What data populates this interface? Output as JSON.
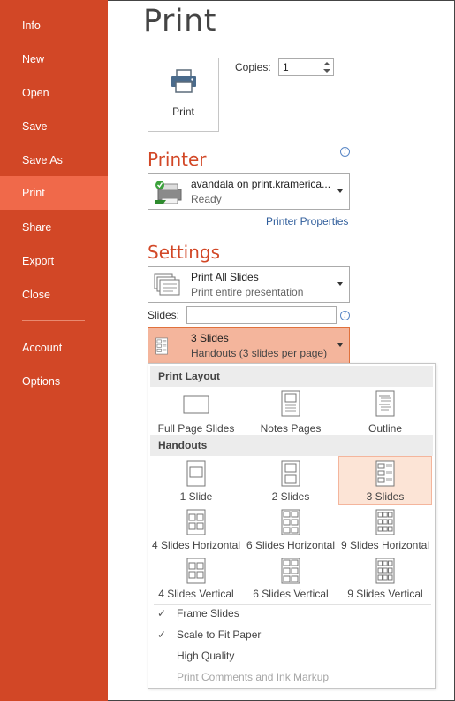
{
  "sidebar": {
    "items": [
      {
        "label": "Info"
      },
      {
        "label": "New"
      },
      {
        "label": "Open"
      },
      {
        "label": "Save"
      },
      {
        "label": "Save As"
      },
      {
        "label": "Print",
        "active": true
      },
      {
        "label": "Share"
      },
      {
        "label": "Export"
      },
      {
        "label": "Close"
      },
      {
        "label": "Account"
      },
      {
        "label": "Options"
      }
    ]
  },
  "page": {
    "title": "Print"
  },
  "print_button": {
    "label": "Print",
    "icon": "printer-icon"
  },
  "copies": {
    "label": "Copies:",
    "value": "1"
  },
  "printer": {
    "section_title": "Printer",
    "name": "avandala on print.kramerica...",
    "status": "Ready",
    "properties_link": "Printer Properties"
  },
  "settings": {
    "section_title": "Settings",
    "range": {
      "title": "Print All Slides",
      "subtitle": "Print entire presentation"
    },
    "slides_label": "Slides:",
    "slides_value": "",
    "layout": {
      "title": "3 Slides",
      "subtitle": "Handouts (3 slides per page)"
    }
  },
  "popup": {
    "print_layout_header": "Print Layout",
    "print_layout_options": [
      {
        "label": "Full Page Slides"
      },
      {
        "label": "Notes Pages"
      },
      {
        "label": "Outline"
      }
    ],
    "handouts_header": "Handouts",
    "handout_options": [
      {
        "label": "1 Slide"
      },
      {
        "label": "2 Slides"
      },
      {
        "label": "3 Slides",
        "selected": true
      },
      {
        "label": "4 Slides Horizontal"
      },
      {
        "label": "6 Slides Horizontal"
      },
      {
        "label": "9 Slides Horizontal"
      },
      {
        "label": "4 Slides Vertical"
      },
      {
        "label": "6 Slides Vertical"
      },
      {
        "label": "9 Slides Vertical"
      }
    ],
    "toggles": [
      {
        "label": "Frame Slides",
        "checked": true
      },
      {
        "label": "Scale to Fit Paper",
        "checked": true
      },
      {
        "label": "High Quality",
        "checked": false
      },
      {
        "label": "Print Comments and Ink Markup",
        "checked": false,
        "disabled": true
      }
    ]
  },
  "colors": {
    "accent": "#d24726",
    "accent_active": "#f0694a",
    "selected_fill": "#f4b59c",
    "link": "#2f5d9b"
  }
}
